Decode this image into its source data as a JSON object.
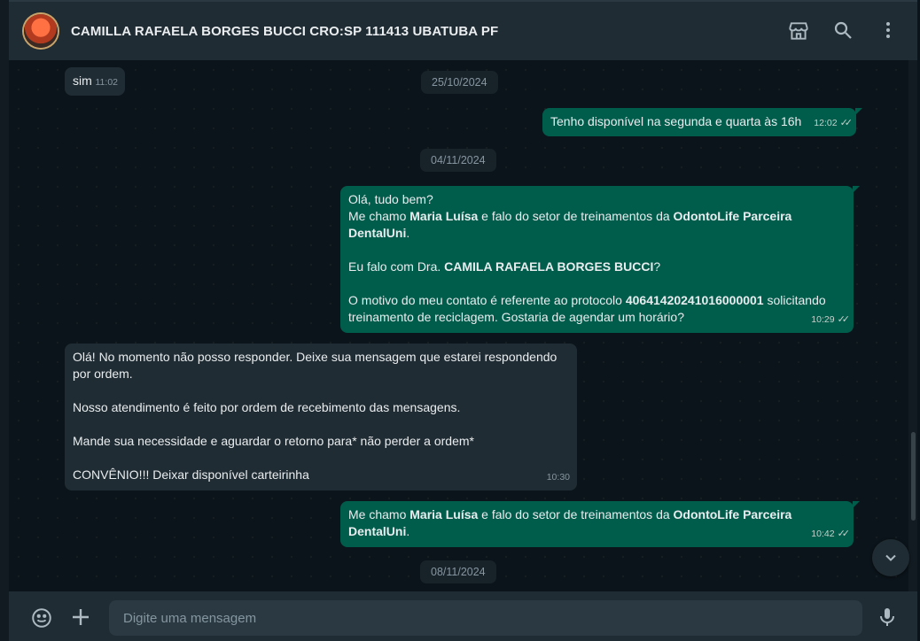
{
  "header": {
    "title": "CAMILLA RAFAELA BORGES BUCCI CRO:SP 111413 UBATUBA PF"
  },
  "messages": {
    "m1": {
      "text": "sim",
      "time": "11:02"
    },
    "d1": "25/10/2024",
    "m2": {
      "text": "Tenho disponível na segunda e quarta às 16h",
      "time": "12:02"
    },
    "d2": "04/11/2024",
    "m3": {
      "l1": "Olá, tudo bem?",
      "l2a": "Me chamo ",
      "l2b": "Maria Luísa",
      "l2c": " e falo do setor de treinamentos da ",
      "l2d": "OdontoLife Parceira DentalUni",
      "l2e": ".",
      "l3a": "Eu falo com Dra. ",
      "l3b": "CAMILA RAFAELA BORGES BUCCI",
      "l3c": "?",
      "l4a": "O motivo do meu contato é referente ao protocolo ",
      "l4b": "40641420241016000001",
      "l4c": " solicitando treinamento de reciclagem. Gostaria de agendar um horário?",
      "time": "10:29"
    },
    "m4": {
      "l1": "Olá! No momento não posso responder. Deixe sua mensagem que estarei respondendo por ordem.",
      "l2": "Nosso atendimento é feito por ordem de recebimento das mensagens.",
      "l3": "Mande sua necessidade e aguardar o retorno para* não perder a ordem*",
      "l4": "CONVÊNIO!!! Deixar disponível carteirinha",
      "time": "10:30"
    },
    "m5": {
      "a": "Me chamo ",
      "b": "Maria Luísa",
      "c": " e falo do setor de treinamentos da ",
      "d": "OdontoLife Parceira DentalUni",
      "e": ".",
      "time": "10:42"
    },
    "d3": "08/11/2024"
  },
  "composer": {
    "placeholder": "Digite uma mensagem"
  },
  "icons": {
    "header": [
      "store-icon",
      "search-icon",
      "menu-dots-icon"
    ],
    "footer": [
      "emoji-icon",
      "plus-icon",
      "mic-icon"
    ],
    "scroll": "chevron-down-icon"
  },
  "colors": {
    "outgoing": "#005c4b",
    "incoming": "#202c33",
    "background": "#0b141a",
    "header": "#202c33"
  }
}
